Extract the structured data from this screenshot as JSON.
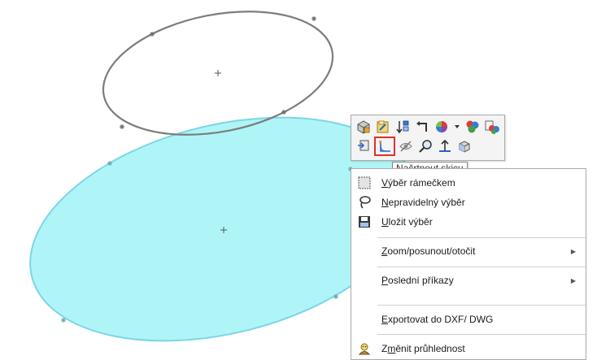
{
  "tooltip": "Načrtnout skicu",
  "toolbar": {
    "row1_icons": [
      "part-icon",
      "edit-sketch-icon",
      "sort-icon",
      "undo-arrow-icon",
      "appearance-icon",
      "dropdown-arrow-icon",
      "color-spheres-icon",
      "display-style-icon"
    ],
    "row2_icons": [
      "view-normal-icon",
      "sketch-icon",
      "hide-icon",
      "zoom-icon",
      "normal-to-icon",
      "view-orientation-icon"
    ],
    "highlighted": "sketch-icon"
  },
  "menu": {
    "box_select": {
      "pre": "",
      "ul": "V",
      "post": "ýběr rámečkem"
    },
    "lasso_select": {
      "pre": "",
      "ul": "N",
      "post": "epravidelný výběr"
    },
    "save_selection": {
      "pre": "",
      "ul": "U",
      "post": "ložit výběr"
    },
    "zoom": {
      "pre": "",
      "ul": "Z",
      "post": "oom/posunout/otočit"
    },
    "recent": {
      "pre": "",
      "ul": "P",
      "post": "oslední příkazy"
    },
    "export": {
      "pre": "",
      "ul": "E",
      "post": "xportovat  do DXF/ DWG"
    },
    "transparency": {
      "pre": "Z",
      "ul": "m",
      "post": "ěnit průhlednost"
    }
  },
  "colors": {
    "face_fill": "#aff5f7",
    "face_stroke": "#7ad6e6",
    "sketch_stroke": "#7d7d7d",
    "highlight": "#e0312b"
  }
}
